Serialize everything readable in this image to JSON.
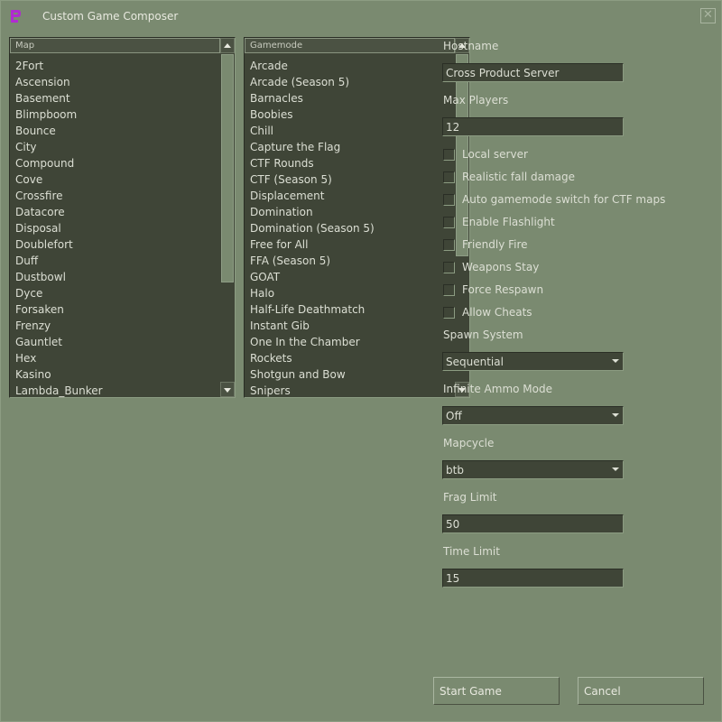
{
  "window": {
    "title": "Custom Game Composer"
  },
  "map_list": {
    "header": "Map",
    "items": [
      "2Fort",
      "Ascension",
      "Basement",
      "Blimpboom",
      "Bounce",
      "City",
      "Compound",
      "Cove",
      "Crossfire",
      "Datacore",
      "Disposal",
      "Doublefort",
      "Duff",
      "Dustbowl",
      "Dyce",
      "Forsaken",
      "Frenzy",
      "Gauntlet",
      "Hex",
      "Kasino",
      "Lambda_Bunker"
    ]
  },
  "gamemode_list": {
    "header": "Gamemode",
    "items": [
      "Arcade",
      "Arcade (Season 5)",
      "Barnacles",
      "Boobies",
      "Chill",
      "Capture the Flag",
      "CTF Rounds",
      "CTF (Season 5)",
      "Displacement",
      "Domination",
      "Domination (Season 5)",
      "Free for All",
      "FFA (Season 5)",
      "GOAT",
      "Halo",
      "Half-Life Deathmatch",
      "Instant Gib",
      "One In the Chamber",
      "Rockets",
      "Shotgun and Bow",
      "Snipers"
    ]
  },
  "form": {
    "hostname_label": "Hostname",
    "hostname_value": "Cross Product Server",
    "max_players_label": "Max Players",
    "max_players_value": "12",
    "checkboxes": [
      {
        "label": "Local server",
        "checked": false
      },
      {
        "label": "Realistic fall damage",
        "checked": false
      },
      {
        "label": "Auto gamemode switch for CTF maps",
        "checked": false
      },
      {
        "label": "Enable Flashlight",
        "checked": false
      },
      {
        "label": "Friendly Fire",
        "checked": false
      },
      {
        "label": "Weapons Stay",
        "checked": false
      },
      {
        "label": "Force Respawn",
        "checked": false
      },
      {
        "label": "Allow Cheats",
        "checked": false
      }
    ],
    "spawn_system_label": "Spawn System",
    "spawn_system_value": "Sequential",
    "infinite_ammo_label": "Infinite Ammo Mode",
    "infinite_ammo_value": "Off",
    "mapcycle_label": "Mapcycle",
    "mapcycle_value": "btb",
    "frag_limit_label": "Frag Limit",
    "frag_limit_value": "50",
    "time_limit_label": "Time Limit",
    "time_limit_value": "15"
  },
  "buttons": {
    "start": "Start Game",
    "cancel": "Cancel"
  },
  "icons": {
    "app": "game-logo-icon",
    "close": "close-icon",
    "scroll_up": "arrow-up-icon",
    "scroll_down": "arrow-down-icon",
    "dropdown": "chevron-down-icon"
  },
  "colors": {
    "background": "#7a8a70",
    "field": "#3f4537",
    "text": "#dcdfd4",
    "logo": "#b02bd1"
  }
}
